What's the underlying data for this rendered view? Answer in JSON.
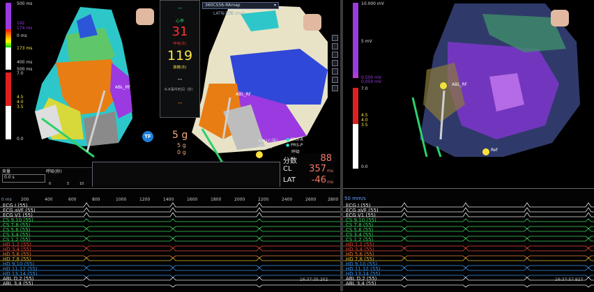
{
  "left_scale": {
    "top_ticks": [
      "500 ms",
      "192",
      "174 ms",
      "0 ms",
      "173 ms",
      "400 ms",
      "500 ms"
    ],
    "bottom_ticks": [
      "7.0",
      "4.5",
      "4.0",
      "3.5",
      "0.0"
    ]
  },
  "map_dropdown": {
    "value": "360CS56-RAmap",
    "sub_label": "LAT标记图 (ms)"
  },
  "vitals": {
    "hr_label": "心率",
    "hr": "31",
    "hr_unit": "呼吸(次)",
    "rr": "119",
    "rr_unit": "脉搏(次)",
    "note": "R‑R事件时间（秒）",
    "dash1": "--",
    "dash2": "--",
    "dash3": "--"
  },
  "force": {
    "badge": "TF",
    "value1": "5 g",
    "value2": "5 g",
    "value3": "0 g"
  },
  "catheter_labels": {
    "left": "ABL_RF",
    "mid": "ABL_RF",
    "right": "ABL_RF"
  },
  "legend": {
    "abl": "ABL(心导)",
    "hd": "HD导管",
    "prs_a": "PRS-A",
    "prs_p": "PRS-P",
    "resp": "呼吸"
  },
  "stats": {
    "count_label": "分数",
    "count": "88",
    "cl_label": "CL",
    "cl": "357",
    "cl_unit": "ms",
    "lat_label": "LAT",
    "lat": "-46",
    "lat_unit": "ms"
  },
  "strip": {
    "title": "夹量",
    "resp_label": "呼吸(秒)",
    "time_a": "0",
    "time_b": "5",
    "time_c": "10",
    "slider_label": "0.0 s"
  },
  "left_ecg": {
    "speed": "0 ms",
    "ticks": [
      "200",
      "400",
      "600",
      "800",
      "1000",
      "1200",
      "1400",
      "1600",
      "1800",
      "2000",
      "2200",
      "2400",
      "2600",
      "2800"
    ],
    "channels": [
      {
        "name": "ECG I (55)",
        "color": "#e8e8e8"
      },
      {
        "name": "ECG aVF (55)",
        "color": "#e8e8e8"
      },
      {
        "name": "ECG V1 (55)",
        "color": "#e8e8e8"
      },
      {
        "name": "CS 9,10 (55)",
        "color": "#3bd15a"
      },
      {
        "name": "CS 7,8 (55)",
        "color": "#3bd15a"
      },
      {
        "name": "CS 5,6 (55)",
        "color": "#3bd15a"
      },
      {
        "name": "CS 3,4 (55)",
        "color": "#3bd15a"
      },
      {
        "name": "CS 1,2 (55)",
        "color": "#3bd15a"
      },
      {
        "name": "HD 1,2 (55)",
        "color": "#e0452f"
      },
      {
        "name": "HD 3,4 (55)",
        "color": "#e0452f"
      },
      {
        "name": "HD 5,6 (55)",
        "color": "#e07a2f"
      },
      {
        "name": "HD 7,8 (55)",
        "color": "#e0b52f"
      },
      {
        "name": "HD 9,10 (55)",
        "color": "#3a8fe0"
      },
      {
        "name": "HD 11,12 (55)",
        "color": "#3a8fe0"
      },
      {
        "name": "HD 13,14 (55)",
        "color": "#3a8fe0"
      },
      {
        "name": "ABL D,2 (55)",
        "color": "#e8e8e8"
      },
      {
        "name": "ABL 3,4 (55)",
        "color": "#e8e8e8"
      }
    ],
    "timestamp": "16:37:35.202"
  },
  "right_scale": {
    "top_ticks": [
      "10.000 mV",
      "5 mV",
      "0.500 mV",
      "0.050 mV"
    ],
    "bottom_ticks": [
      "7.0",
      "4.5",
      "4.0",
      "3.5",
      "0.0"
    ]
  },
  "right_ecg": {
    "speed": "50 mm/s",
    "channels": [
      {
        "name": "ECG I (55)",
        "color": "#e8e8e8"
      },
      {
        "name": "ECG aVF (55)",
        "color": "#e8e8e8"
      },
      {
        "name": "ECG V1 (55)",
        "color": "#e8e8e8"
      },
      {
        "name": "CS 9,10 (55)",
        "color": "#3bd15a"
      },
      {
        "name": "CS 7,8 (55)",
        "color": "#3bd15a"
      },
      {
        "name": "CS 5,6 (55)",
        "color": "#3bd15a"
      },
      {
        "name": "CS 3,4 (55)",
        "color": "#3bd15a"
      },
      {
        "name": "CS 1,2 (55)",
        "color": "#3bd15a"
      },
      {
        "name": "HD 1,2 (55)",
        "color": "#e0452f"
      },
      {
        "name": "HD 3,4 (55)",
        "color": "#e0452f"
      },
      {
        "name": "HD 5,6 (55)",
        "color": "#e07a2f"
      },
      {
        "name": "HD 7,8 (55)",
        "color": "#e0b52f"
      },
      {
        "name": "HD 9,10 (55)",
        "color": "#3a8fe0"
      },
      {
        "name": "HD 11,12 (55)",
        "color": "#3a8fe0"
      },
      {
        "name": "HD 13,14 (55)",
        "color": "#3a8fe0"
      },
      {
        "name": "ABL D,2 (55)",
        "color": "#e8e8e8"
      },
      {
        "name": "ABL 3,4 (55)",
        "color": "#e8e8e8"
      }
    ],
    "timestamp": "16:37:57.927"
  },
  "right_map_label": "Ref",
  "colors": {
    "green_accent": "#2bd16b",
    "purple": "#9b3ae0",
    "red_value": "#ff3030",
    "yellow_value": "#ffe84a"
  }
}
